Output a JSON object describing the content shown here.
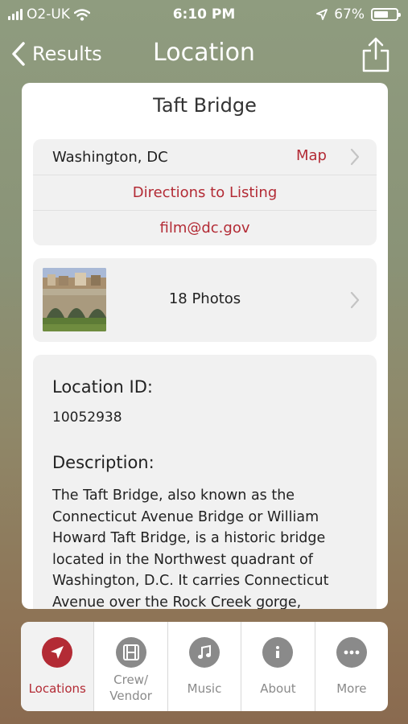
{
  "status_bar": {
    "carrier": "O2-UK",
    "time": "6:10 PM",
    "battery": "67%",
    "battery_level": 0.67
  },
  "nav": {
    "back_label": "Results",
    "title": "Location"
  },
  "location": {
    "name": "Taft Bridge",
    "city": "Washington, DC",
    "map_label": "Map",
    "directions_label": "Directions to Listing",
    "email": "film@dc.gov",
    "photos_label": "18 Photos",
    "id_heading": "Location ID:",
    "id_value": "10052938",
    "description_heading": "Description:",
    "description": "The Taft Bridge, also known as the Connecticut Avenue Bridge or William Howard Taft Bridge, is a historic bridge located in the Northwest quadrant of Washington, D.C. It carries Connecticut Avenue over the Rock Creek gorge,"
  },
  "tabs": [
    {
      "label": "Locations",
      "icon": "location-arrow-icon",
      "active": true
    },
    {
      "label": "Crew/\nVendor",
      "icon": "film-icon",
      "active": false
    },
    {
      "label": "Music",
      "icon": "music-note-icon",
      "active": false
    },
    {
      "label": "About",
      "icon": "info-icon",
      "active": false
    },
    {
      "label": "More",
      "icon": "more-icon",
      "active": false
    }
  ],
  "colors": {
    "accent": "#b32b35",
    "inactive": "#8a8a8a"
  }
}
